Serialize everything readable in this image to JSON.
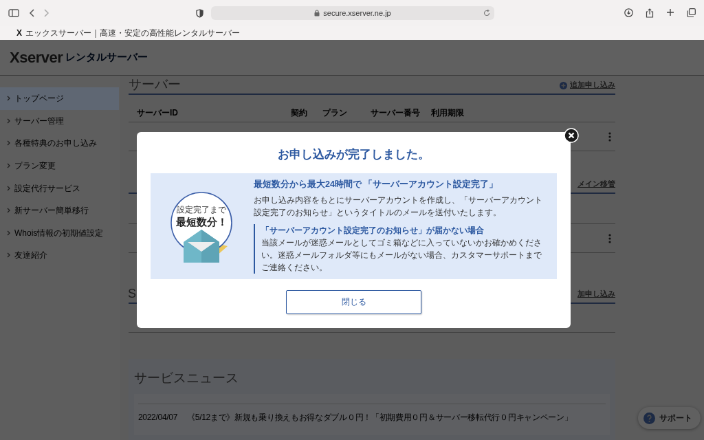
{
  "browser": {
    "url": "secure.xserver.ne.jp",
    "tab_logo": "X",
    "tab_title": "エックスサーバー｜高速・安定の高性能レンタルサーバー"
  },
  "header": {
    "logo": "Xserver",
    "logo_sub": "レンタルサーバー"
  },
  "sidebar": {
    "items": [
      {
        "label": "トップページ",
        "selected": true
      },
      {
        "label": "サーバー管理",
        "selected": false
      },
      {
        "label": "各種特典のお申し込み",
        "selected": false
      },
      {
        "label": "プラン変更",
        "selected": false
      },
      {
        "label": "設定代行サービス",
        "selected": false
      },
      {
        "label": "新サーバー簡単移行",
        "selected": false
      },
      {
        "label": "Whois情報の初期値設定",
        "selected": false
      },
      {
        "label": "友達紹介",
        "selected": false
      }
    ]
  },
  "server_section": {
    "title": "サーバー",
    "add_link": "追加申し込み",
    "columns": [
      "サーバーID",
      "契約",
      "プラン",
      "サーバー番号",
      "利用期限"
    ]
  },
  "domain_section": {
    "add_link": "メイン移管"
  },
  "third_section": {
    "title": "S",
    "add_link": "加申し込み"
  },
  "news": {
    "title": "サービスニュース",
    "items": [
      {
        "date": "2022/04/07",
        "text": "《5/12まで》新規も乗り換えもお得なダブル０円！「初期費用０円＆サーバー移転代行０円キャンペーン」"
      }
    ]
  },
  "support_button": "サポート",
  "modal": {
    "title": "お申し込みが完了しました。",
    "badge_small": "設定完了まで",
    "badge_big": "最短数分！",
    "heading": "最短数分から最大24時間で 「サーバーアカウント設定完了」",
    "body": "お申し込み内容をもとにサーバーアカウントを作成し、「サーバーアカウント設定完了のお知らせ」というタイトルのメールを送付いたします。",
    "note_title": "「サーバーアカウント設定完了のお知らせ」が届かない場合",
    "note_body": "当該メールが迷惑メールとしてゴミ箱などに入っていないかお確かめください。迷惑メールフォルダ等にもメールがない場合、カスタマーサポートまでご連絡ください。",
    "close_button": "閉じる"
  }
}
